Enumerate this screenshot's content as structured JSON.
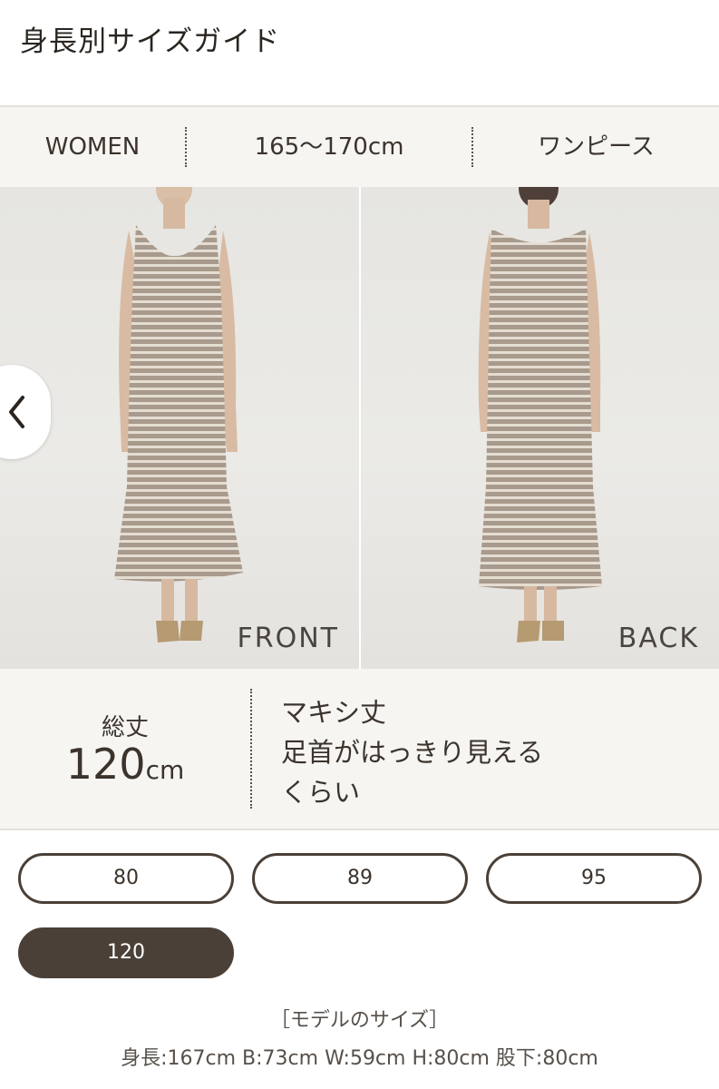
{
  "header": {
    "title": "身長別サイズガイド"
  },
  "filters": [
    {
      "label": "WOMEN"
    },
    {
      "label": "165〜170cm"
    },
    {
      "label": "ワンピース"
    }
  ],
  "gallery": {
    "front_label": "FRONT",
    "back_label": "BACK",
    "prev_icon": "chevron-left-icon"
  },
  "garment": {
    "length_label": "総丈",
    "length_value": "120",
    "length_unit": "cm",
    "description_lines": [
      "マキシ丈",
      "足首がはっきり見える",
      "くらい"
    ]
  },
  "sizes": [
    {
      "label": "80",
      "active": false
    },
    {
      "label": "89",
      "active": false
    },
    {
      "label": "95",
      "active": false
    },
    {
      "label": "120",
      "active": true
    }
  ],
  "model": {
    "title": "［モデルのサイズ］",
    "stats": "身長:167cm B:73cm W:59cm H:80cm 股下:80cm"
  },
  "colors": {
    "accent": "#4a4038",
    "panel_bg": "#f6f5f2",
    "text": "#3b332c"
  }
}
